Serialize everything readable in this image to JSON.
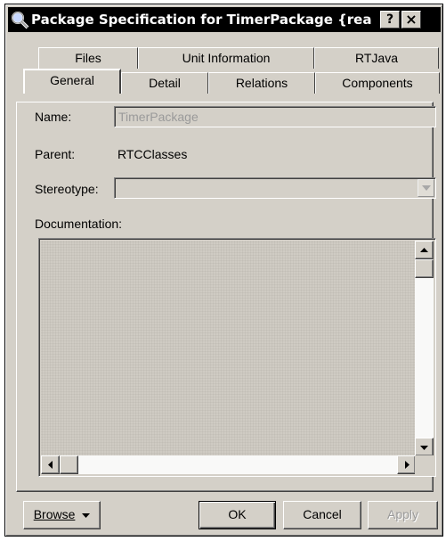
{
  "window": {
    "title": "Package Specification for TimerPackage {read-...",
    "help_button": "?",
    "close_button": "×"
  },
  "tabs": {
    "row_back": [
      {
        "label": "Files"
      },
      {
        "label": "Unit Information"
      },
      {
        "label": "RTJava"
      }
    ],
    "row_front": [
      {
        "label": "General",
        "active": true
      },
      {
        "label": "Detail"
      },
      {
        "label": "Relations"
      },
      {
        "label": "Components"
      }
    ]
  },
  "form": {
    "name_label": "Name:",
    "name_value": "TimerPackage",
    "parent_label": "Parent:",
    "parent_value": "RTCClasses",
    "stereotype_label": "Stereotype:",
    "stereotype_value": "",
    "documentation_label": "Documentation:",
    "documentation_value": ""
  },
  "buttons": {
    "browse": "Browse",
    "ok": "OK",
    "cancel": "Cancel",
    "apply": "Apply"
  },
  "icons": {
    "title": "magnifier-icon",
    "browse_dropdown": "triangle-down-icon",
    "stereotype_dropdown": "triangle-down-icon",
    "scroll_up": "triangle-up-icon",
    "scroll_down": "triangle-down-icon",
    "scroll_left": "triangle-left-icon",
    "scroll_right": "triangle-right-icon"
  },
  "colors": {
    "face": "#d4d0c8",
    "titlebar": "#000000",
    "disabled_text": "#9a9a9a"
  }
}
